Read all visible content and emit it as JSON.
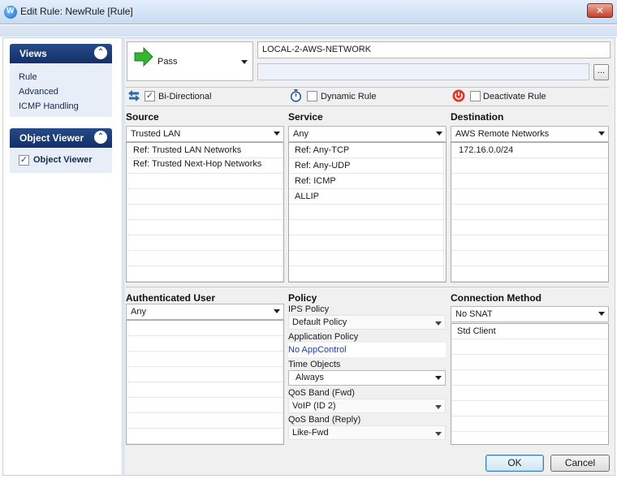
{
  "window": {
    "title": "Edit Rule: NewRule [Rule]",
    "close_label": "✕"
  },
  "nav": {
    "views_title": "Views",
    "views_items": [
      "Rule",
      "Advanced",
      "ICMP Handling"
    ],
    "object_viewer_title": "Object Viewer",
    "object_viewer_item": "Object Viewer",
    "object_viewer_checked": true,
    "collapse_glyph": "⌃"
  },
  "rule": {
    "action": "Pass",
    "name": "LOCAL-2-AWS-NETWORK",
    "comment": "",
    "browse_label": "..."
  },
  "options": {
    "bidirectional": {
      "label": "Bi-Directional",
      "checked": true
    },
    "dynamic": {
      "label": "Dynamic Rule",
      "checked": false
    },
    "deactivate": {
      "label": "Deactivate Rule",
      "checked": false
    }
  },
  "source": {
    "title": "Source",
    "selected": "Trusted  LAN",
    "items": [
      "Ref: Trusted LAN Networks",
      "Ref: Trusted Next-Hop Networks"
    ]
  },
  "service": {
    "title": "Service",
    "selected": "Any",
    "items": [
      "Ref: Any-TCP",
      "Ref: Any-UDP",
      "Ref: ICMP",
      "ALLIP"
    ]
  },
  "destination": {
    "title": "Destination",
    "selected": "AWS Remote Networks",
    "items": [
      "172.16.0.0/24"
    ]
  },
  "auth_user": {
    "title": "Authenticated User",
    "selected": "Any",
    "items": []
  },
  "policy": {
    "title": "Policy",
    "ips_label": "IPS Policy",
    "ips_value": "Default Policy",
    "app_label": "Application Policy",
    "app_value": "No AppControl",
    "time_label": "Time Objects",
    "time_value": "Always",
    "qos_fwd_label": "QoS Band (Fwd)",
    "qos_fwd_value": "VoIP (ID 2)",
    "qos_reply_label": "QoS Band (Reply)",
    "qos_reply_value": "Like-Fwd"
  },
  "connection": {
    "title": "Connection Method",
    "selected": "No SNAT",
    "items": [
      "Std Client"
    ]
  },
  "buttons": {
    "ok": "OK",
    "cancel": "Cancel"
  },
  "icons": {
    "action": "green-arrow-icon",
    "bidirectional": "bidirectional-arrows-icon",
    "dynamic": "stopwatch-icon",
    "deactivate": "power-icon"
  },
  "colors": {
    "nav_header": "#1b3a74",
    "link": "#1c3fa8",
    "action_green": "#2fae2f"
  }
}
